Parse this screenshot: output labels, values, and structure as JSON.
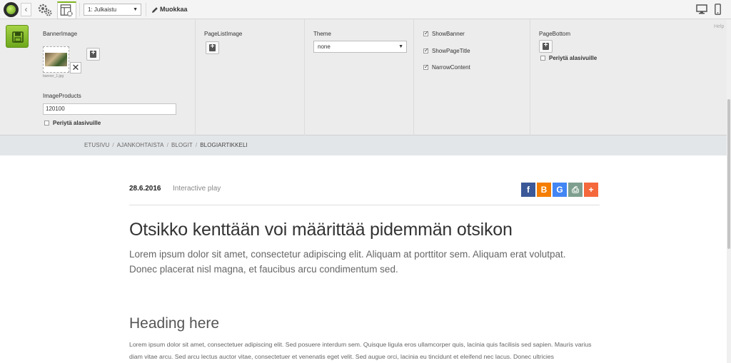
{
  "toolbar": {
    "version_select": "1: Julkaistu",
    "edit_label": "Muokkaa",
    "colors": {
      "accent": "#7fb51f"
    },
    "icons": [
      "logo-icon",
      "chevron-left-icon",
      "gear-icon",
      "page-settings-icon",
      "pencil-icon",
      "desktop-icon",
      "mobile-icon"
    ]
  },
  "panel": {
    "banner_image_label": "BannerImage",
    "banner_image_filename": "banner_1.jpg",
    "image_products_label": "ImageProducts",
    "image_products_value": "120100",
    "inherit_label": "Periytä alasivuille",
    "page_list_image_label": "PageListImage",
    "theme_label": "Theme",
    "theme_value": "none",
    "show_banner": {
      "label": "ShowBanner",
      "checked": true
    },
    "show_page_title": {
      "label": "ShowPageTitle",
      "checked": true
    },
    "narrow_content": {
      "label": "NarrowContent",
      "checked": true
    },
    "page_bottom_label": "PageBottom",
    "page_bottom_inherit_label": "Periytä alasivuille",
    "help_label": "Help"
  },
  "breadcrumb": {
    "items": [
      "ETUSIVU",
      "AJANKOHTAISTA",
      "BLOGIT",
      "BLOGIARTIKKELI"
    ],
    "separator": "/"
  },
  "article": {
    "date": "28.6.2016",
    "author": "Interactive play",
    "share": [
      {
        "name": "facebook",
        "glyph": "f",
        "color": "#3b5998"
      },
      {
        "name": "blogger",
        "glyph": "B",
        "color": "#f57d00"
      },
      {
        "name": "google",
        "glyph": "G",
        "color": "#4285f4"
      },
      {
        "name": "print",
        "glyph": "⎙",
        "color": "#7e9f8f"
      },
      {
        "name": "more",
        "glyph": "+",
        "color": "#f4683c"
      }
    ],
    "title": "Otsikko kenttään voi määrittää pidemmän otsikon",
    "lead": "Lorem ipsum dolor sit amet, consectetur adipiscing elit. Aliquam at porttitor sem. Aliquam erat volutpat. Donec placerat nisl magna, et faucibus arcu condimentum sed.",
    "heading": "Heading here",
    "body": "Lorem ipsum dolor sit amet, consectetuer adipiscing elit. Sed posuere interdum sem. Quisque ligula eros ullamcorper quis, lacinia quis facilisis sed sapien. Mauris varius diam vitae arcu. Sed arcu lectus auctor vitae, consectetuer et venenatis eget velit. Sed augue orci, lacinia eu tincidunt et eleifend nec lacus. Donec ultricies"
  }
}
